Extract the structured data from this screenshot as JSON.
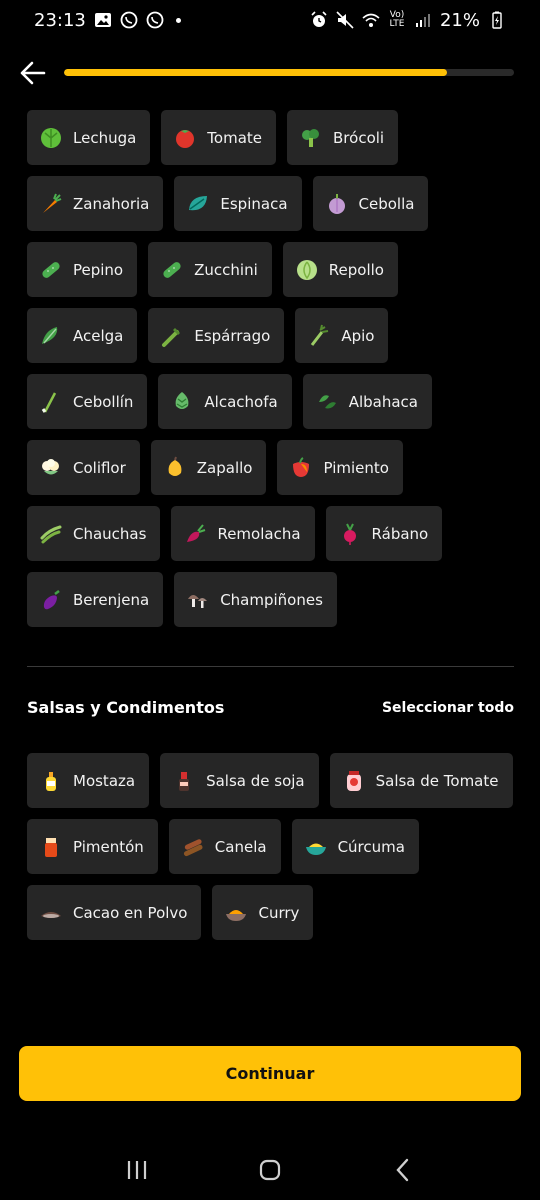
{
  "status_bar": {
    "time": "23:13",
    "battery": "21%",
    "network_label": "Vo) LTE"
  },
  "header": {
    "back_icon": "arrow-left-icon",
    "progress_fraction": 0.85,
    "accent_color": "#ffc107"
  },
  "vegetables": {
    "rows": [
      [
        {
          "label": "Lechuga",
          "icon": "lettuce-icon"
        },
        {
          "label": "Tomate",
          "icon": "tomato-icon"
        },
        {
          "label": "Brócoli",
          "icon": "broccoli-icon"
        }
      ],
      [
        {
          "label": "Zanahoria",
          "icon": "carrot-icon"
        },
        {
          "label": "Espinaca",
          "icon": "leaf-icon"
        },
        {
          "label": "Cebolla",
          "icon": "onion-icon"
        }
      ],
      [
        {
          "label": "Pepino",
          "icon": "cucumber-icon"
        },
        {
          "label": "Zucchini",
          "icon": "cucumber-icon"
        },
        {
          "label": "Repollo",
          "icon": "cabbage-icon"
        }
      ],
      [
        {
          "label": "Acelga",
          "icon": "chard-icon"
        },
        {
          "label": "Espárrago",
          "icon": "asparagus-icon"
        },
        {
          "label": "Apio",
          "icon": "celery-icon"
        }
      ],
      [
        {
          "label": "Cebollín",
          "icon": "scallion-icon"
        },
        {
          "label": "Alcachofa",
          "icon": "artichoke-icon"
        },
        {
          "label": "Albahaca",
          "icon": "basil-icon"
        }
      ],
      [
        {
          "label": "Coliflor",
          "icon": "cauliflower-icon"
        },
        {
          "label": "Zapallo",
          "icon": "squash-icon"
        },
        {
          "label": "Pimiento",
          "icon": "pepper-icon"
        }
      ],
      [
        {
          "label": "Chauchas",
          "icon": "beans-icon"
        },
        {
          "label": "Remolacha",
          "icon": "beet-icon"
        },
        {
          "label": "Rábano",
          "icon": "radish-icon"
        }
      ],
      [
        {
          "label": "Berenjena",
          "icon": "eggplant-icon"
        },
        {
          "label": "Champiñones",
          "icon": "mushroom-icon"
        }
      ]
    ]
  },
  "sauces": {
    "title": "Salsas y Condimentos",
    "select_all": "Seleccionar todo",
    "rows": [
      [
        {
          "label": "Mostaza",
          "icon": "mustard-icon"
        },
        {
          "label": "Salsa de soja",
          "icon": "soy-sauce-icon"
        },
        {
          "label": "Salsa de Tomate",
          "icon": "ketchup-icon"
        }
      ],
      [
        {
          "label": "Pimentón",
          "icon": "paprika-icon"
        },
        {
          "label": "Canela",
          "icon": "cinnamon-icon"
        },
        {
          "label": "Cúrcuma",
          "icon": "turmeric-icon"
        }
      ],
      [
        {
          "label": "Cacao en Polvo",
          "icon": "cocoa-icon"
        },
        {
          "label": "Curry",
          "icon": "curry-icon"
        }
      ]
    ]
  },
  "footer": {
    "continue_label": "Continuar"
  },
  "nav": {
    "recents_icon": "recents-icon",
    "home_icon": "home-icon",
    "back_icon": "nav-back-icon"
  }
}
